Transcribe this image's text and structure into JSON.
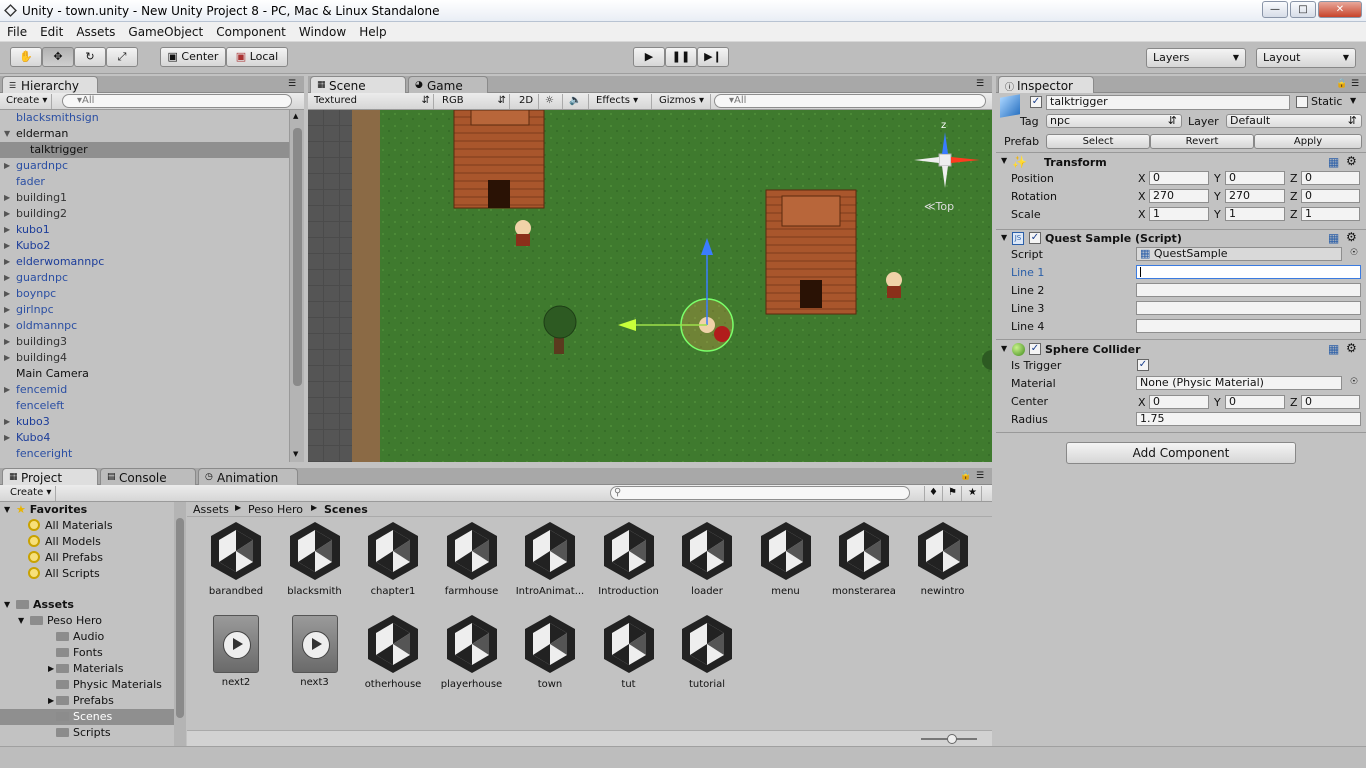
{
  "window": {
    "title": "Unity - town.unity - New Unity Project 8 - PC, Mac & Linux Standalone"
  },
  "menu": [
    "File",
    "Edit",
    "Assets",
    "GameObject",
    "Component",
    "Window",
    "Help"
  ],
  "toolbar": {
    "pivot": "Center",
    "space": "Local",
    "layers": "Layers",
    "layout": "Layout"
  },
  "hierarchy": {
    "tab": "Hierarchy",
    "create": "Create",
    "search": "▾All",
    "items": [
      {
        "name": "blacksmithsign",
        "color": "#2b4fa3",
        "arrow": false,
        "indent": 0
      },
      {
        "name": "elderman",
        "color": "#111111",
        "arrow": true,
        "open": true,
        "indent": 0
      },
      {
        "name": "talktrigger",
        "color": "#111111",
        "arrow": false,
        "indent": 1,
        "selected": true
      },
      {
        "name": "guardnpc",
        "color": "#2b4fa3",
        "arrow": true,
        "indent": 0
      },
      {
        "name": "fader",
        "color": "#2b4fa3",
        "arrow": false,
        "indent": 0
      },
      {
        "name": "building1",
        "color": "#333333",
        "arrow": true,
        "indent": 0
      },
      {
        "name": "building2",
        "color": "#333333",
        "arrow": true,
        "indent": 0
      },
      {
        "name": "kubo1",
        "color": "#1c3d9a",
        "arrow": true,
        "indent": 0
      },
      {
        "name": "Kubo2",
        "color": "#1c3d9a",
        "arrow": true,
        "indent": 0
      },
      {
        "name": "elderwomannpc",
        "color": "#1c3d9a",
        "arrow": true,
        "indent": 0
      },
      {
        "name": "guardnpc",
        "color": "#2b4fa3",
        "arrow": true,
        "indent": 0
      },
      {
        "name": "boynpc",
        "color": "#2b4fa3",
        "arrow": true,
        "indent": 0
      },
      {
        "name": "girlnpc",
        "color": "#2b4fa3",
        "arrow": true,
        "indent": 0
      },
      {
        "name": "oldmannpc",
        "color": "#2b4fa3",
        "arrow": true,
        "indent": 0
      },
      {
        "name": "building3",
        "color": "#333333",
        "arrow": true,
        "indent": 0
      },
      {
        "name": "building4",
        "color": "#333333",
        "arrow": true,
        "indent": 0
      },
      {
        "name": "Main Camera",
        "color": "#111111",
        "arrow": false,
        "indent": 0
      },
      {
        "name": "fencemid",
        "color": "#2b4fa3",
        "arrow": true,
        "indent": 0
      },
      {
        "name": "fenceleft",
        "color": "#2b4fa3",
        "arrow": false,
        "indent": 0
      },
      {
        "name": "kubo3",
        "color": "#1c3d9a",
        "arrow": true,
        "indent": 0
      },
      {
        "name": "Kubo4",
        "color": "#1c3d9a",
        "arrow": true,
        "indent": 0
      },
      {
        "name": "fenceright",
        "color": "#2b4fa3",
        "arrow": false,
        "indent": 0
      }
    ]
  },
  "scene": {
    "tab_scene": "Scene",
    "tab_game": "Game",
    "shading": "Textured",
    "render": "RGB",
    "mode2d": "2D",
    "effects": "Effects",
    "gizmos": "Gizmos",
    "search": "▾All",
    "gizmo_label": "Top",
    "axis_z": "z"
  },
  "inspector": {
    "tab": "Inspector",
    "name": "talktrigger",
    "static": "Static",
    "tag_label": "Tag",
    "tag": "npc",
    "layer_label": "Layer",
    "layer": "Default",
    "prefab_label": "Prefab",
    "select": "Select",
    "revert": "Revert",
    "apply": "Apply",
    "transform": {
      "title": "Transform",
      "position_label": "Position",
      "rotation_label": "Rotation",
      "scale_label": "Scale",
      "position": [
        "0",
        "0",
        "0"
      ],
      "rotation": [
        "270",
        "270",
        "0"
      ],
      "scale": [
        "1",
        "1",
        "1"
      ]
    },
    "quest": {
      "title": "Quest Sample (Script)",
      "script_label": "Script",
      "script": "QuestSample",
      "line1": "Line 1",
      "line2": "Line 2",
      "line3": "Line 3",
      "line4": "Line 4"
    },
    "collider": {
      "title": "Sphere Collider",
      "trigger_label": "Is Trigger",
      "material_label": "Material",
      "material": "None (Physic Material)",
      "center_label": "Center",
      "center": [
        "0",
        "0",
        "0"
      ],
      "radius_label": "Radius",
      "radius": "1.75"
    },
    "add_component": "Add Component",
    "axis": [
      "X",
      "Y",
      "Z"
    ]
  },
  "project": {
    "tab": "Project",
    "console": "Console",
    "animation": "Animation",
    "create": "Create",
    "favorites_title": "Favorites",
    "favorites": [
      "All Materials",
      "All Models",
      "All Prefabs",
      "All Scripts"
    ],
    "assets_title": "Assets",
    "tree": [
      {
        "name": "Peso Hero",
        "indent": 1,
        "arrow": true
      },
      {
        "name": "Audio",
        "indent": 2,
        "arrow": false
      },
      {
        "name": "Fonts",
        "indent": 2,
        "arrow": false
      },
      {
        "name": "Materials",
        "indent": 2,
        "arrow": true
      },
      {
        "name": "Physic Materials",
        "indent": 2,
        "arrow": false
      },
      {
        "name": "Prefabs",
        "indent": 2,
        "arrow": true
      },
      {
        "name": "Scenes",
        "indent": 2,
        "arrow": false,
        "selected": true
      },
      {
        "name": "Scripts",
        "indent": 2,
        "arrow": false
      }
    ],
    "breadcrumb": [
      "Assets",
      "Peso Hero",
      "Scenes"
    ],
    "assets": [
      {
        "name": "barandbed",
        "kind": "unity"
      },
      {
        "name": "blacksmith",
        "kind": "unity"
      },
      {
        "name": "chapter1",
        "kind": "unity"
      },
      {
        "name": "farmhouse",
        "kind": "unity"
      },
      {
        "name": "IntroAnimat...",
        "kind": "unity"
      },
      {
        "name": "Introduction",
        "kind": "unity"
      },
      {
        "name": "loader",
        "kind": "unity"
      },
      {
        "name": "menu",
        "kind": "unity"
      },
      {
        "name": "monsterarea",
        "kind": "unity"
      },
      {
        "name": "newintro",
        "kind": "unity"
      },
      {
        "name": "next2",
        "kind": "video"
      },
      {
        "name": "next3",
        "kind": "video"
      },
      {
        "name": "otherhouse",
        "kind": "unity"
      },
      {
        "name": "playerhouse",
        "kind": "unity"
      },
      {
        "name": "town",
        "kind": "unity"
      },
      {
        "name": "tut",
        "kind": "unity"
      },
      {
        "name": "tutorial",
        "kind": "unity"
      }
    ]
  }
}
